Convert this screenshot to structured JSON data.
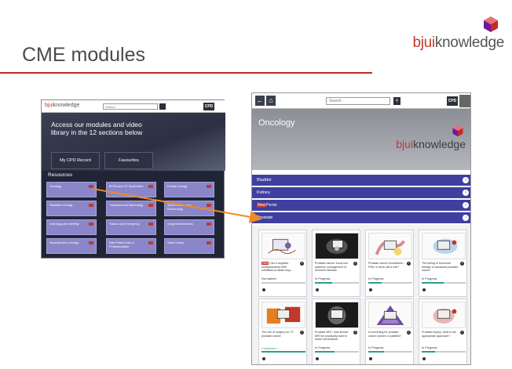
{
  "slide": {
    "title": "CME modules",
    "brand_prefix": "bjui",
    "brand_suffix": "knowledge"
  },
  "left_screenshot": {
    "logo_prefix": "bjui",
    "logo_suffix": "knowledge",
    "search_placeholder": "Search",
    "cpd_label": "CPD",
    "hero_text": "Access our modules and video library in the 12 sections below",
    "btn_record": "My CPD Record",
    "btn_favourites": "Favourites",
    "resources_heading": "Resources",
    "tiles": [
      {
        "label": "Oncology"
      },
      {
        "label": "BPS/Lower UT Dysfunction"
      },
      {
        "label": "Female Urology"
      },
      {
        "label": "Paediatric Urology"
      },
      {
        "label": "Transplant and Nephrology"
      },
      {
        "label": "Stone Disease and Endourology"
      },
      {
        "label": "Andrology and Infertility"
      },
      {
        "label": "Trauma and Emergency"
      },
      {
        "label": "Urogenital Infections"
      },
      {
        "label": "Reconstructive Urology"
      },
      {
        "label": "Safe Patient Care & Professionalism"
      },
      {
        "label": "Video Library"
      }
    ]
  },
  "right_screenshot": {
    "search_placeholder": "Search",
    "cpd_label": "CPD",
    "hero_title": "Oncology",
    "hero_logo_prefix": "bjui",
    "hero_logo_suffix": "knowledge",
    "sections": [
      {
        "label": "Bladder",
        "new": false
      },
      {
        "label": "Kidney",
        "new": false
      },
      {
        "label": "Penis",
        "new": true,
        "new_label": "New"
      },
      {
        "label": "Prostate",
        "new": false
      }
    ],
    "cards": [
      {
        "title": "Can a negative multiparametric MRI substitute prostate biop...",
        "new": true,
        "new_label": "New",
        "status": "Not started",
        "progress": 0.0,
        "status_done": false
      },
      {
        "title": "Prostate cancer: focal and systemic management of recurrent disease",
        "new": false,
        "status": "In Progress",
        "progress": 0.4,
        "status_done": false
      },
      {
        "title": "Prostate cancer biomarkers - PSA: is there still a role?",
        "new": false,
        "status": "In Progress",
        "progress": 0.3,
        "status_done": false
      },
      {
        "title": "The timing of hormonal therapy in advanced prostate cancer",
        "new": false,
        "status": "In Progress",
        "progress": 0.5,
        "status_done": false
      },
      {
        "title": "The role of surgery for T3 prostate cancer",
        "new": false,
        "status": "Completed ✓",
        "progress": 1.0,
        "status_done": true
      },
      {
        "title": "Prostate MRI - how should MRI be practically used in active surveillance",
        "new": false,
        "status": "In Progress",
        "progress": 0.45,
        "status_done": false
      },
      {
        "title": "Is screening for prostate cancer proven or justified?",
        "new": false,
        "status": "In Progress",
        "progress": 0.35,
        "status_done": false
      },
      {
        "title": "Prostate biopsy: what is the appropriate approach?",
        "new": false,
        "status": "In Progress",
        "progress": 0.3,
        "status_done": false
      }
    ]
  },
  "colors": {
    "accent_red": "#c62828",
    "section_blue": "#3f3fa0",
    "tile_purple": "#8a86c9",
    "arrow_orange": "#f08a24",
    "progress_teal": "#2a9d8f"
  }
}
